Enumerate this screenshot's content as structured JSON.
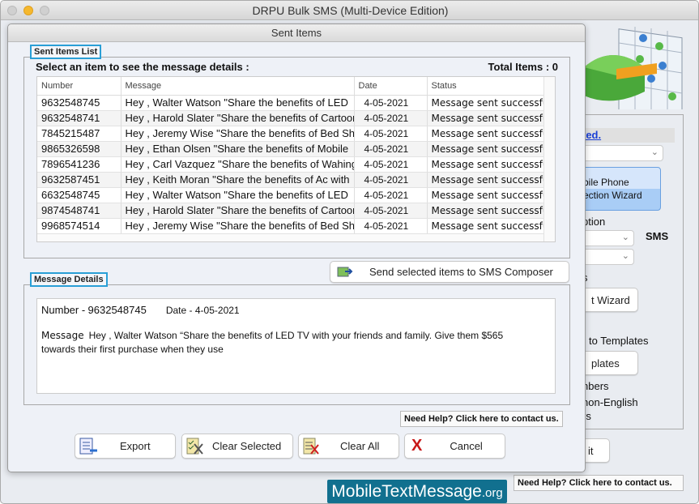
{
  "app": {
    "title": "DRPU Bulk SMS (Multi-Device Edition)"
  },
  "background_panel": {
    "colon": ":",
    "link": "ted.",
    "wizard_line1": "bile Phone",
    "wizard_line2": "ection  Wizard",
    "option_label": "ption",
    "sms_label": "SMS",
    "s_label": "s",
    "wizard_btn": "t Wizard",
    "templates_label": "to Templates",
    "templates_btn": "plates",
    "numbers_label": "nbers",
    "non_english": "non-English",
    "rs_label": "rs",
    "exit_btn": "it",
    "help": "Need Help? Click here to contact us."
  },
  "dialog": {
    "title": "Sent Items",
    "list_group": "Sent Items List",
    "instruction": "Select an item to see the message details :",
    "total_items": "Total Items : 0",
    "columns": [
      "Number",
      "Message",
      "Date",
      "Status"
    ],
    "rows": [
      {
        "number": "9632548745",
        "message": "Hey , Walter Watson \"Share the benefits of LED",
        "date": "4-05-2021",
        "status": "Message sent successfully"
      },
      {
        "number": "9632548741",
        "message": "Hey , Harold Slater \"Share the benefits of Cartoon",
        "date": "4-05-2021",
        "status": "Message sent successfully"
      },
      {
        "number": "7845215487",
        "message": "Hey , Jeremy Wise \"Share the benefits of Bed Sheet",
        "date": "4-05-2021",
        "status": "Message sent successfully"
      },
      {
        "number": "9865326598",
        "message": "Hey , Ethan Olsen \"Share the benefits of Mobile",
        "date": "4-05-2021",
        "status": "Message sent successfully"
      },
      {
        "number": "7896541236",
        "message": "Hey , Carl Vazquez \"Share the benefits of Wahing",
        "date": "4-05-2021",
        "status": "Message sent successfully"
      },
      {
        "number": "9632587451",
        "message": "Hey , Keith Moran \"Share the benefits of Ac with",
        "date": "4-05-2021",
        "status": "Message sent successfully"
      },
      {
        "number": "6632548745",
        "message": "Hey , Walter Watson \"Share the benefits of LED",
        "date": "4-05-2021",
        "status": "Message sent successfully"
      },
      {
        "number": "9874548741",
        "message": "Hey , Harold Slater \"Share the benefits of Cartoon",
        "date": "4-05-2021",
        "status": "Message sent successfully"
      },
      {
        "number": "9968574514",
        "message": "Hey , Jeremy Wise \"Share the benefits of Bed Sheet",
        "date": "4-05-2021",
        "status": "Message sent successfully"
      }
    ],
    "send_to_composer": "Send selected items to SMS Composer",
    "details_group": "Message Details",
    "details": {
      "number_label": "Number -",
      "number": "9632548745",
      "date_label": "Date -",
      "date": "4-05-2021",
      "message_label": "Message",
      "message": "Hey , Walter Watson “Share the benefits of LED TV with your friends and family. Give them $565 towards their first purchase when they use"
    },
    "help": "Need Help? Click here to contact us.",
    "buttons": {
      "export": "Export",
      "clear_selected": "Clear Selected",
      "clear_all": "Clear All",
      "cancel": "Cancel"
    }
  },
  "logo": {
    "main": "MobileTextMessage",
    "suffix": ".org"
  }
}
